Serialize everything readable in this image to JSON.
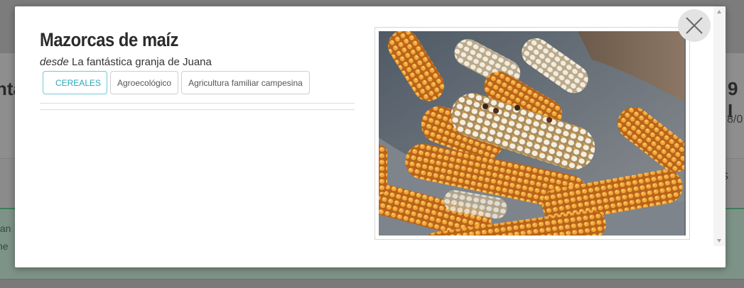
{
  "background": {
    "left_title_fragment": "ntá",
    "right_title_fragment": "9 I",
    "right_date_fragment": "8/0",
    "right_letter_fragment": "S",
    "notice_line1_fragment": "fan",
    "notice_line2_fragment": "ne"
  },
  "modal": {
    "title": "Mazorcas de maíz",
    "from_prefix": "desde",
    "producer": "La fantástica granja de Juana",
    "tags": [
      {
        "label": "CEREALES",
        "kind": "category"
      },
      {
        "label": "Agroecológico",
        "kind": "attribute"
      },
      {
        "label": "Agricultura familiar campesina",
        "kind": "attribute"
      }
    ],
    "image_alt": "Mazorcas de maíz",
    "close_icon": "close-icon"
  },
  "colors": {
    "category_tag": "#28a8b8",
    "notice_border": "#3e7d5a"
  }
}
